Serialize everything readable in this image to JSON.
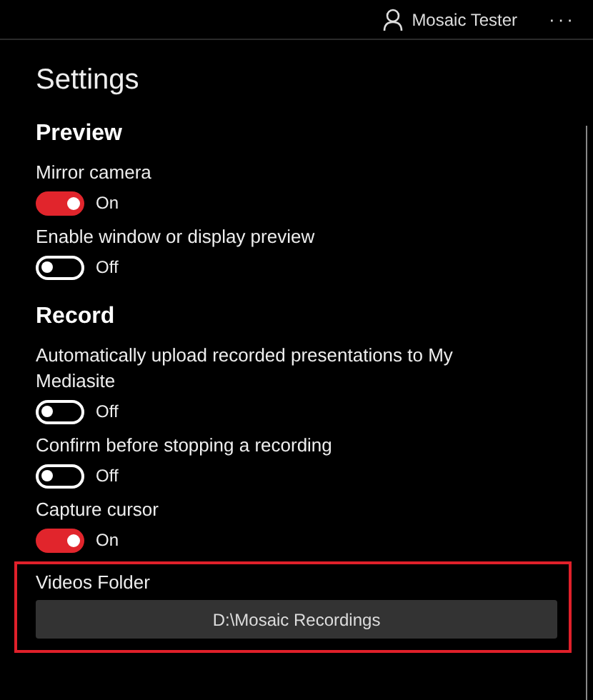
{
  "header": {
    "user": "Mosaic Tester",
    "more": "···"
  },
  "title": "Settings",
  "sections": [
    {
      "heading": "Preview",
      "items": [
        {
          "label": "Mirror camera",
          "on": true,
          "state_label": "On"
        },
        {
          "label": "Enable window or display preview",
          "on": false,
          "state_label": "Off"
        }
      ]
    },
    {
      "heading": "Record",
      "items": [
        {
          "label": "Automatically upload recorded presentations to My Mediasite",
          "on": false,
          "state_label": "Off"
        },
        {
          "label": "Confirm before stopping a recording",
          "on": false,
          "state_label": "Off"
        },
        {
          "label": "Capture cursor",
          "on": true,
          "state_label": "On"
        }
      ]
    }
  ],
  "videos_folder": {
    "label": "Videos Folder",
    "value": "D:\\Mosaic Recordings",
    "highlighted": true
  }
}
